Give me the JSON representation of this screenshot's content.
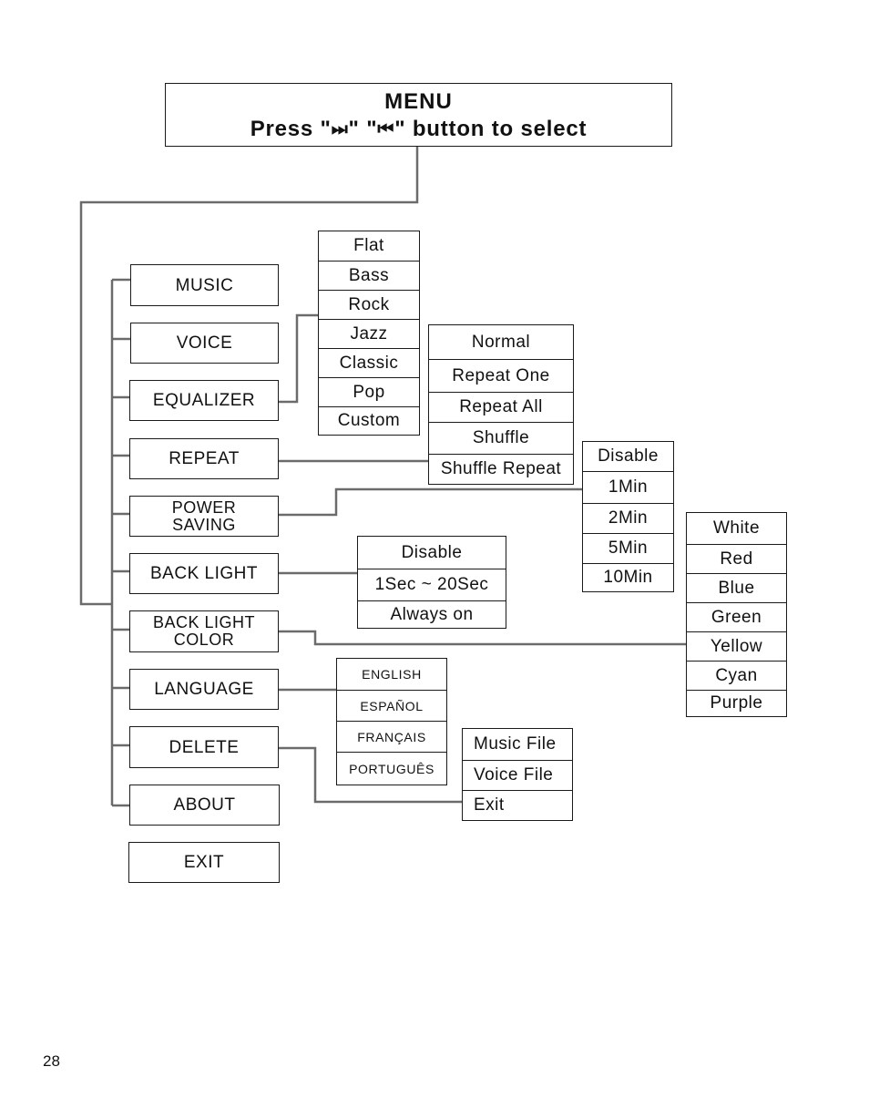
{
  "header": {
    "title": "MENU",
    "instruction_prefix": "Press \"",
    "next_icon": "⏭",
    "instruction_mid": "\"  \"",
    "prev_icon": "⏮",
    "instruction_suffix": "\" button to select"
  },
  "main_menu": [
    {
      "label": "MUSIC"
    },
    {
      "label": "VOICE"
    },
    {
      "label": "EQUALIZER"
    },
    {
      "label": "REPEAT"
    },
    {
      "label_line1": "POWER",
      "label_line2": "SAVING"
    },
    {
      "label": "BACK LIGHT"
    },
    {
      "label_line1": "BACK LIGHT",
      "label_line2": "COLOR"
    },
    {
      "label": "LANGUAGE"
    },
    {
      "label": "DELETE"
    },
    {
      "label": "ABOUT"
    },
    {
      "label": "EXIT"
    }
  ],
  "submenus": {
    "equalizer": [
      "Flat",
      "Bass",
      "Rock",
      "Jazz",
      "Classic",
      "Pop",
      "Custom"
    ],
    "repeat": [
      "Normal",
      "Repeat One",
      "Repeat All",
      "Shuffle",
      "Shuffle Repeat"
    ],
    "power_saving": [
      "Disable",
      "1Min",
      "2Min",
      "5Min",
      "10Min"
    ],
    "back_light": [
      "Disable",
      "1Sec ~ 20Sec",
      "Always on"
    ],
    "back_light_color": [
      "White",
      "Red",
      "Blue",
      "Green",
      "Yellow",
      "Cyan",
      "Purple"
    ],
    "language": [
      "ENGLISH",
      "ESPAÑOL",
      "FRANÇAIS",
      "PORTUGUÊS"
    ],
    "delete": [
      "Music File",
      "Voice File",
      "Exit"
    ]
  },
  "page_number": "28"
}
